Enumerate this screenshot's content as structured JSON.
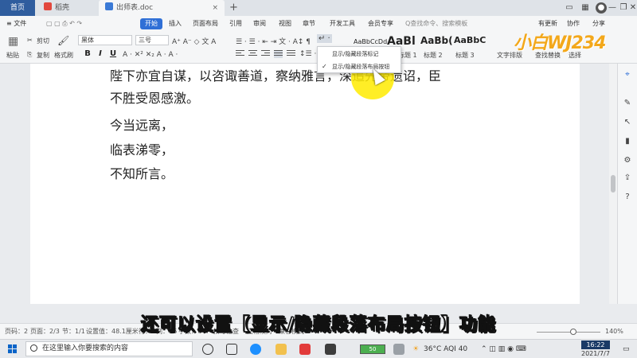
{
  "tabs": {
    "home": "首页",
    "daoke": "稻壳",
    "doc": "出师表.doc",
    "close": "×",
    "new": "+"
  },
  "menu": {
    "file": "≡ 文件",
    "start": "开始",
    "items": [
      "插入",
      "页面布局",
      "引用",
      "审阅",
      "视图",
      "章节",
      "开发工具",
      "会员专享"
    ],
    "search": "Q查找命令、搜索模板",
    "right": [
      "有更新",
      "协作",
      "分享"
    ]
  },
  "ribbon": {
    "paste": "粘贴",
    "cut": "剪切",
    "copy": "复制",
    "format_painter": "格式刷",
    "font_name": "黑体",
    "font_size": "三号",
    "bold": "B",
    "italic": "I",
    "underline": "U",
    "styles": [
      {
        "preview": "AaBbCcDd",
        "caption": "正文"
      },
      {
        "preview": "AaBl",
        "caption": "标题 1"
      },
      {
        "preview": "AaBb(",
        "caption": "标题 2"
      },
      {
        "preview": "AaBbC",
        "caption": "标题 3"
      }
    ],
    "text_layout": "文字排版",
    "find_replace": "查找替换",
    "select": "选择"
  },
  "dropdown": {
    "item1": "显示/隐藏段落标记",
    "item2": "显示/隐藏段落布局按钮",
    "check": "✓"
  },
  "logo": "小白WJ234",
  "document": {
    "lines": [
      "陛下亦宜自谋，以咨诹善道，察纳雅言，深追先帝遗诏，臣",
      "不胜受恩感激。",
      "今当远离，",
      "临表涕零，",
      "不知所言。"
    ]
  },
  "subtitle": "还可以设置【显示/隐藏段落布局按钮】功能",
  "status": {
    "page": "页码：2",
    "pages": "页面：2/3",
    "section": "节：1/1",
    "setting": "设置值：48.1厘米",
    "row": "行：3",
    "col": "列：26",
    "words": "字数：747",
    "spell": "拼写检查",
    "proof": "文档校对",
    "compat": "兼容模式",
    "zoom": "140%"
  },
  "taskbar": {
    "search_placeholder": "在这里输入你要搜索的内容",
    "battery": "50",
    "weather": "36°C AQI 40",
    "time": "16:22",
    "date": "2021/7/7"
  },
  "colors": {
    "accent": "#2f6fd6",
    "highlight": "#ffeb00",
    "logo": "#f3a81b"
  }
}
